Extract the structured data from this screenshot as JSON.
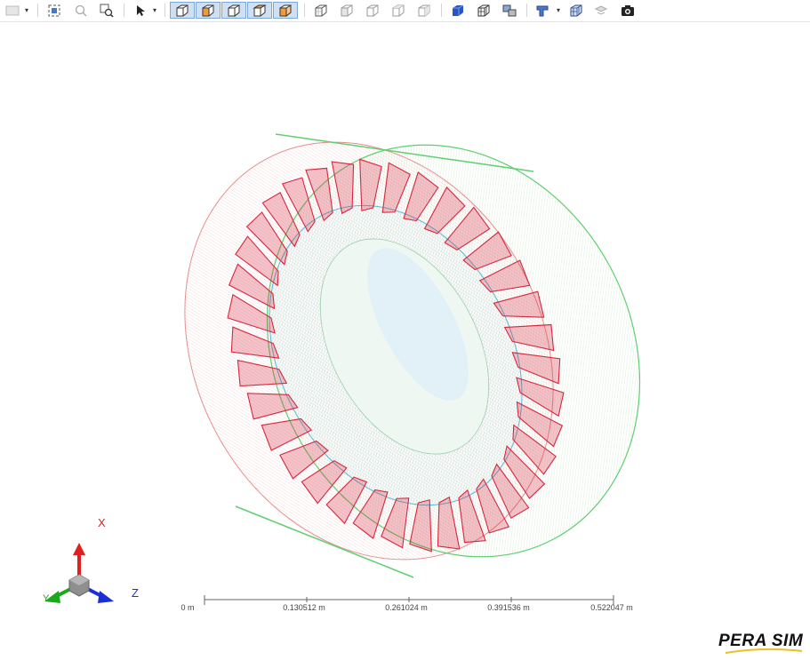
{
  "toolbar": {
    "groups": [
      {
        "name": "display-style",
        "items": [
          "display-mode-button",
          "dropdown"
        ]
      },
      {
        "name": "zoom",
        "items": [
          "zoom-fit-button",
          "zoom-selection-button",
          "zoom-window-button"
        ]
      },
      {
        "name": "select",
        "items": [
          "select-pointer-button",
          "dropdown"
        ]
      },
      {
        "name": "view-orientation",
        "items": [
          "view-iso-1",
          "view-iso-2",
          "view-iso-3",
          "view-iso-4",
          "view-iso-5"
        ]
      },
      {
        "name": "wireframe-views",
        "items": [
          "wire-view-1",
          "wire-view-2",
          "wire-view-3",
          "wire-view-4",
          "wire-view-5"
        ]
      },
      {
        "name": "render-mode",
        "items": [
          "shaded-button",
          "wireframe-button",
          "section-button"
        ]
      },
      {
        "name": "tools",
        "items": [
          "measure-button",
          "dropdown",
          "mesh-button",
          "explode-button",
          "screenshot-button"
        ]
      }
    ]
  },
  "triad": {
    "x_label": "X",
    "y_label": "Y",
    "z_label": "Z",
    "x_color": "#e02020",
    "y_color": "#1ca81c",
    "z_color": "#1a2fd6"
  },
  "scale_bar": {
    "ticks": [
      "0 m",
      "0.130512 m",
      "0.261024 m",
      "0.391536 m",
      "0.522047 m"
    ]
  },
  "logo": {
    "text": "PERA SIM"
  },
  "model": {
    "description_colors": {
      "blades": "#d6283f",
      "casing": "#6fbf6f",
      "inner": "#7fd6e6"
    },
    "blade_count": 36
  }
}
